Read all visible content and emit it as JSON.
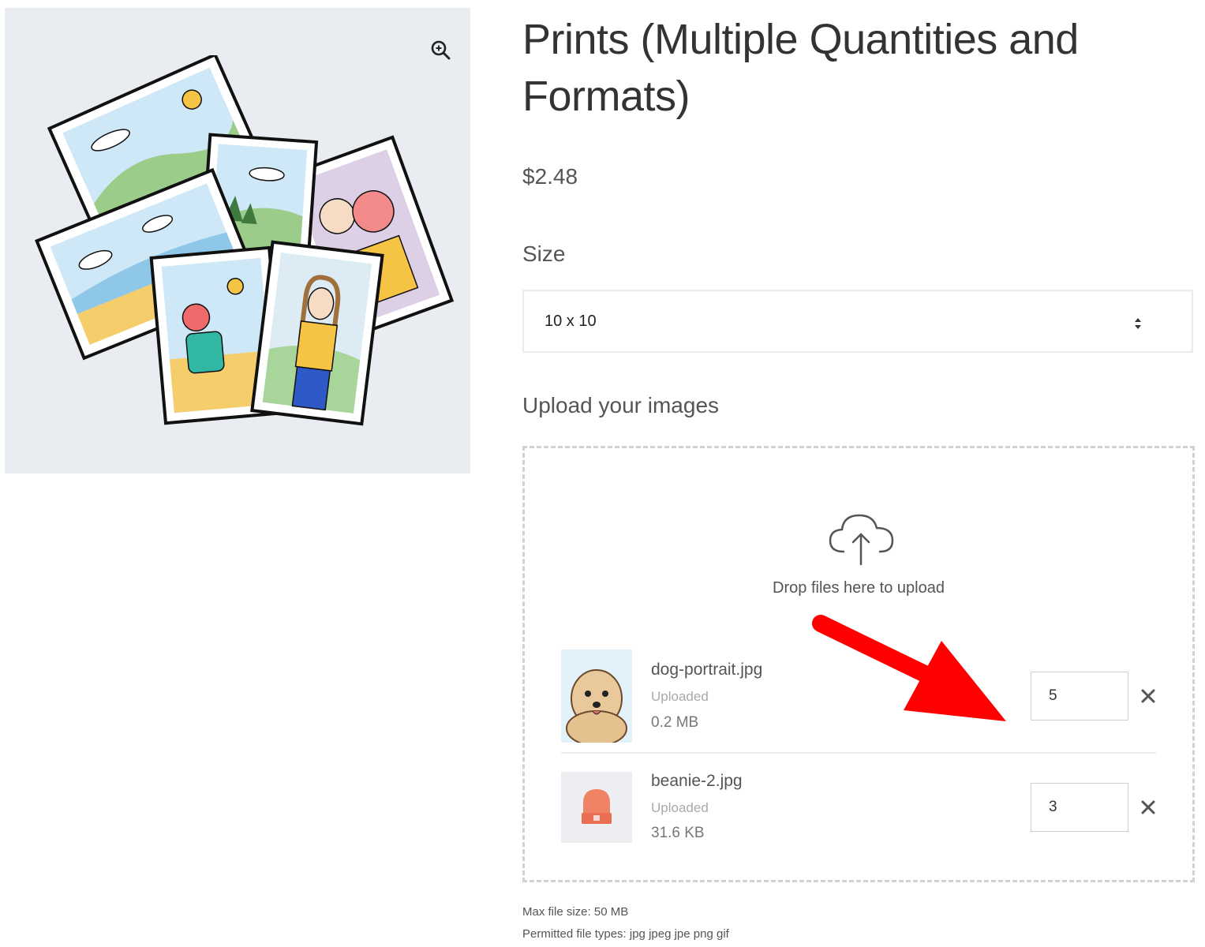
{
  "product": {
    "title": "Prints (Multiple Quantities and Formats)",
    "price": "$2.48"
  },
  "gallery": {
    "zoom_icon": "zoom-in-icon",
    "image_subject": "illustration-of-scattered-photo-prints"
  },
  "size": {
    "label": "Size",
    "selected": "10 x 10"
  },
  "upload": {
    "label": "Upload your images",
    "drop_text": "Drop files here to upload",
    "cloud_icon": "cloud-upload-icon",
    "files": [
      {
        "name": "dog-portrait.jpg",
        "status": "Uploaded",
        "size": "0.2 MB",
        "quantity": "5"
      },
      {
        "name": "beanie-2.jpg",
        "status": "Uploaded",
        "size": "31.6 KB",
        "quantity": "3"
      }
    ],
    "max_file_size": "Max file size: 50 MB",
    "permitted_types": "Permitted file types: jpg jpeg jpe png gif"
  },
  "annotation": {
    "arrow_color": "#ff0000"
  }
}
